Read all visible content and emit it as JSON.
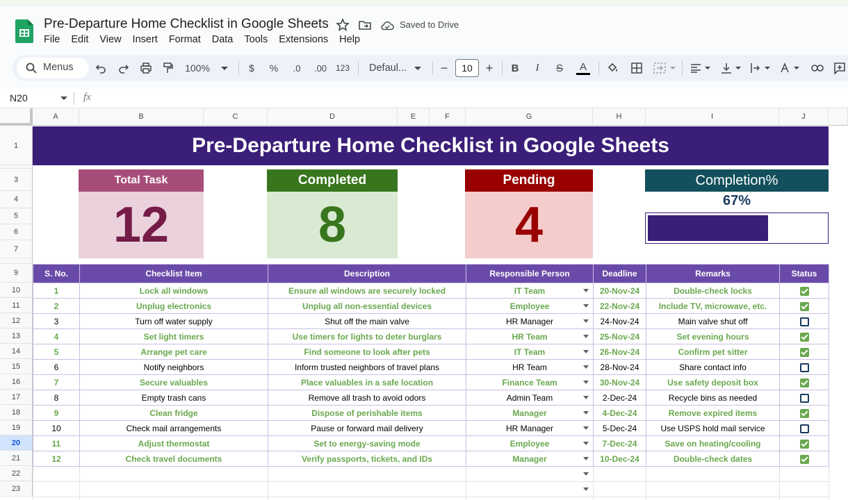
{
  "app": {
    "title": "Pre-Departure Home Checklist in Google Sheets",
    "saved_status": "Saved to Drive",
    "menu": [
      "File",
      "Edit",
      "View",
      "Insert",
      "Format",
      "Data",
      "Tools",
      "Extensions",
      "Help"
    ]
  },
  "toolbar": {
    "menus_label": "Menus",
    "zoom": "100%",
    "currency": "$",
    "percent": "%",
    "dec_decrease": ".0",
    "dec_increase": ".00",
    "number_format": "123",
    "font": "Defaul...",
    "font_size": "10",
    "bold": "B",
    "italic": "I",
    "strike": "S",
    "text_color": "A"
  },
  "formula_bar": {
    "cell_ref": "N20",
    "fx": "fx"
  },
  "columns": [
    "A",
    "B",
    "C",
    "D",
    "E",
    "F",
    "G",
    "H",
    "I",
    "J"
  ],
  "rows": [
    "1",
    "2",
    "3",
    "4",
    "5",
    "6",
    "7",
    "8",
    "9",
    "10",
    "11",
    "12",
    "13",
    "14",
    "15",
    "16",
    "17",
    "18",
    "19",
    "20",
    "21",
    "22",
    "23"
  ],
  "active_row": "20",
  "banner": "Pre-Departure Home Checklist in Google Sheets",
  "cards": {
    "total": {
      "label": "Total Task",
      "value": "12",
      "head_color": "#a64d79",
      "body_color": "#ead1dc",
      "value_color": "#741b47"
    },
    "completed": {
      "label": "Completed",
      "value": "8",
      "head_color": "#38761d",
      "body_color": "#d9ead3",
      "value_color": "#38761d"
    },
    "pending": {
      "label": "Pending",
      "value": "4",
      "head_color": "#990000",
      "body_color": "#f4cccc",
      "value_color": "#990000"
    },
    "completion": {
      "label": "Completion%",
      "value": "67%",
      "fraction": 0.67,
      "head_color": "#134f5c"
    }
  },
  "table": {
    "headers": [
      "S. No.",
      "Checklist Item",
      "Description",
      "Responsible Person",
      "Deadline",
      "Remarks",
      "Status"
    ],
    "rows": [
      {
        "no": "1",
        "item": "Lock all windows",
        "desc": "Ensure all windows are securely locked",
        "person": "IT Team",
        "deadline": "20-Nov-24",
        "remarks": "Double-check locks",
        "done": true
      },
      {
        "no": "2",
        "item": "Unplug electronics",
        "desc": "Unplug all non-essential devices",
        "person": "Employee",
        "deadline": "22-Nov-24",
        "remarks": "Include TV, microwave, etc.",
        "done": true
      },
      {
        "no": "3",
        "item": "Turn off water supply",
        "desc": "Shut off the main valve",
        "person": "HR Manager",
        "deadline": "24-Nov-24",
        "remarks": "Main valve shut off",
        "done": false
      },
      {
        "no": "4",
        "item": "Set light timers",
        "desc": "Use timers for lights to deter burglars",
        "person": "HR Team",
        "deadline": "25-Nov-24",
        "remarks": "Set evening hours",
        "done": true
      },
      {
        "no": "5",
        "item": "Arrange pet care",
        "desc": "Find someone to look after pets",
        "person": "IT Team",
        "deadline": "26-Nov-24",
        "remarks": "Confirm pet sitter",
        "done": true
      },
      {
        "no": "6",
        "item": "Notify neighbors",
        "desc": "Inform trusted neighbors of travel plans",
        "person": "HR Team",
        "deadline": "28-Nov-24",
        "remarks": "Share contact info",
        "done": false
      },
      {
        "no": "7",
        "item": "Secure valuables",
        "desc": "Place valuables in a safe location",
        "person": "Finance Team",
        "deadline": "30-Nov-24",
        "remarks": "Use safety deposit box",
        "done": true
      },
      {
        "no": "8",
        "item": "Empty trash cans",
        "desc": "Remove all trash to avoid odors",
        "person": "Admin Team",
        "deadline": "2-Dec-24",
        "remarks": "Recycle bins as needed",
        "done": false
      },
      {
        "no": "9",
        "item": "Clean fridge",
        "desc": "Dispose of perishable items",
        "person": "Manager",
        "deadline": "4-Dec-24",
        "remarks": "Remove expired items",
        "done": true
      },
      {
        "no": "10",
        "item": "Check mail arrangements",
        "desc": "Pause or forward mail delivery",
        "person": "HR Manager",
        "deadline": "5-Dec-24",
        "remarks": "Use USPS hold mail service",
        "done": false
      },
      {
        "no": "11",
        "item": "Adjust thermostat",
        "desc": "Set to energy-saving mode",
        "person": "Employee",
        "deadline": "7-Dec-24",
        "remarks": "Save on heating/cooling",
        "done": true
      },
      {
        "no": "12",
        "item": "Check travel documents",
        "desc": "Verify passports, tickets, and IDs",
        "person": "Manager",
        "deadline": "10-Dec-24",
        "remarks": "Double-check dates",
        "done": true
      }
    ]
  }
}
